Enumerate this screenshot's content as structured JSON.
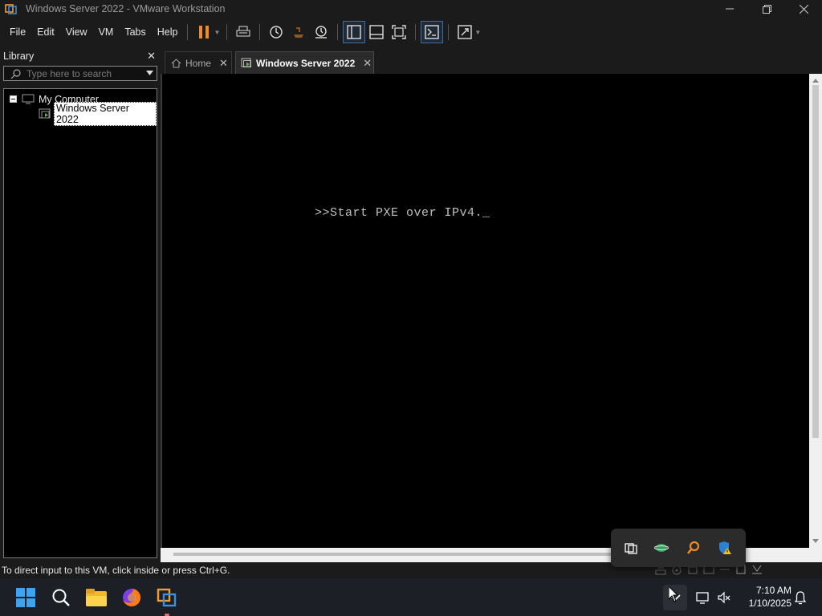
{
  "window": {
    "title": "Windows Server 2022 - VMware Workstation",
    "controls": [
      "minimize",
      "restore",
      "close"
    ]
  },
  "menu": [
    "File",
    "Edit",
    "View",
    "VM",
    "Tabs",
    "Help"
  ],
  "toolbar": {
    "buttons": [
      "pause-icon",
      "send-ctrl-alt-del-icon",
      "snapshot-icon",
      "revert-snapshot-icon",
      "snapshot-manager-icon",
      "show-library-icon",
      "thumbnail-bar-icon",
      "full-screen-icon",
      "console-view-icon",
      "stretch-icon"
    ],
    "accent_color": "#f08a24"
  },
  "library": {
    "title": "Library",
    "search_placeholder": "Type here to search",
    "tree": {
      "root": "My Computer",
      "children": [
        "Windows Server 2022"
      ]
    }
  },
  "tabs": [
    {
      "label": "Home",
      "active": false
    },
    {
      "label": "Windows Server 2022",
      "active": true
    }
  ],
  "console": {
    "text": ">>Start PXE over IPv4._",
    "text_color": "#c0c0c0",
    "background": "#000000"
  },
  "statusbar": {
    "text": "To direct input to this VM, click inside or press Ctrl+G."
  },
  "tray_popup": {
    "icons": [
      "vmware-tray-icon",
      "network-globe-icon",
      "search-tool-icon",
      "defender-warning-icon"
    ]
  },
  "taskbar": {
    "apps": [
      "start-icon",
      "search-icon",
      "file-explorer-icon",
      "firefox-icon",
      "vmware-icon"
    ],
    "clock": {
      "time": "7:10 AM",
      "date": "1/10/2025"
    }
  }
}
